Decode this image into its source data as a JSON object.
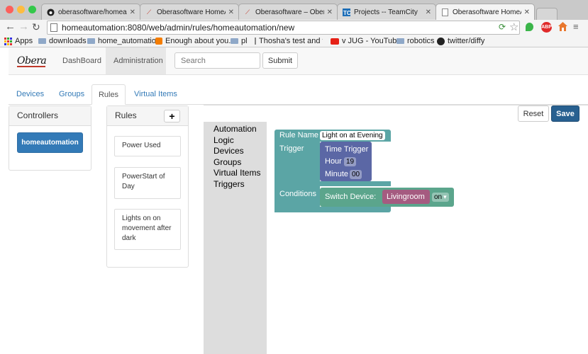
{
  "browser": {
    "tabs": [
      {
        "title": "oberasoftware/homeautoma",
        "icon": "github-icon"
      },
      {
        "title": "Oberasoftware HomeAutoma",
        "icon": "feather-icon"
      },
      {
        "title": "Oberasoftware – Oberasoftw",
        "icon": "feather-icon"
      },
      {
        "title": "Projects -- TeamCity",
        "icon": "teamcity-icon"
      },
      {
        "title": "Oberasoftware HomeAutoma",
        "icon": "page-icon"
      }
    ],
    "url": "homeautomation:8080/web/admin/rules/homeautomation/new",
    "bookmarks": [
      {
        "label": "Apps",
        "icon": "apps-grid-icon"
      },
      {
        "label": "downloads",
        "icon": "folder-icon"
      },
      {
        "label": "home_automation",
        "icon": "folder-icon"
      },
      {
        "label": "Enough about you...",
        "icon": "blogger-icon"
      },
      {
        "label": "pl",
        "icon": "folder-icon"
      },
      {
        "label": "Thosha's test and te",
        "icon": "page-icon"
      },
      {
        "label": "v JUG - YouTube",
        "icon": "youtube-icon"
      },
      {
        "label": "robotics",
        "icon": "folder-icon"
      },
      {
        "label": "twitter/diffy",
        "icon": "github-icon"
      }
    ],
    "extensions": {
      "abp": "ABP"
    }
  },
  "navbar": {
    "brand": "Obera",
    "links": [
      "DashBoard",
      "Administration"
    ],
    "search_placeholder": "Search",
    "submit_label": "Submit"
  },
  "tabs": [
    "Devices",
    "Groups",
    "Rules",
    "Virtual Items"
  ],
  "controllers": {
    "title": "Controllers",
    "items": [
      "homeautomation"
    ]
  },
  "rules": {
    "title": "Rules",
    "add_label": "+",
    "items": [
      "Power Used",
      "PowerStart of Day",
      "Lights on on movement after dark"
    ]
  },
  "editor": {
    "reset_label": "Reset",
    "save_label": "Save",
    "toolbox": [
      "Automation",
      "Logic",
      "Devices",
      "Groups",
      "Virtual Items",
      "Triggers"
    ],
    "blocks": {
      "rule_name_label": "Rule Name",
      "rule_name_value": "Light on at Evening",
      "trigger_label": "Trigger",
      "time_trigger_label": "Time Trigger",
      "hour_label": "Hour",
      "hour_value": "19",
      "minute_label": "Minute",
      "minute_value": "00",
      "conditions_label": "Conditions",
      "switch_device_label": "Switch Device:",
      "device_value": "Livingroom",
      "state_value": "on",
      "dropdown_arrow": "▾"
    },
    "colors": {
      "rule_block": "#5ba5a5",
      "time_block": "#5b67a5",
      "switch_block": "#5ba58c",
      "device_block": "#a55b80"
    }
  }
}
